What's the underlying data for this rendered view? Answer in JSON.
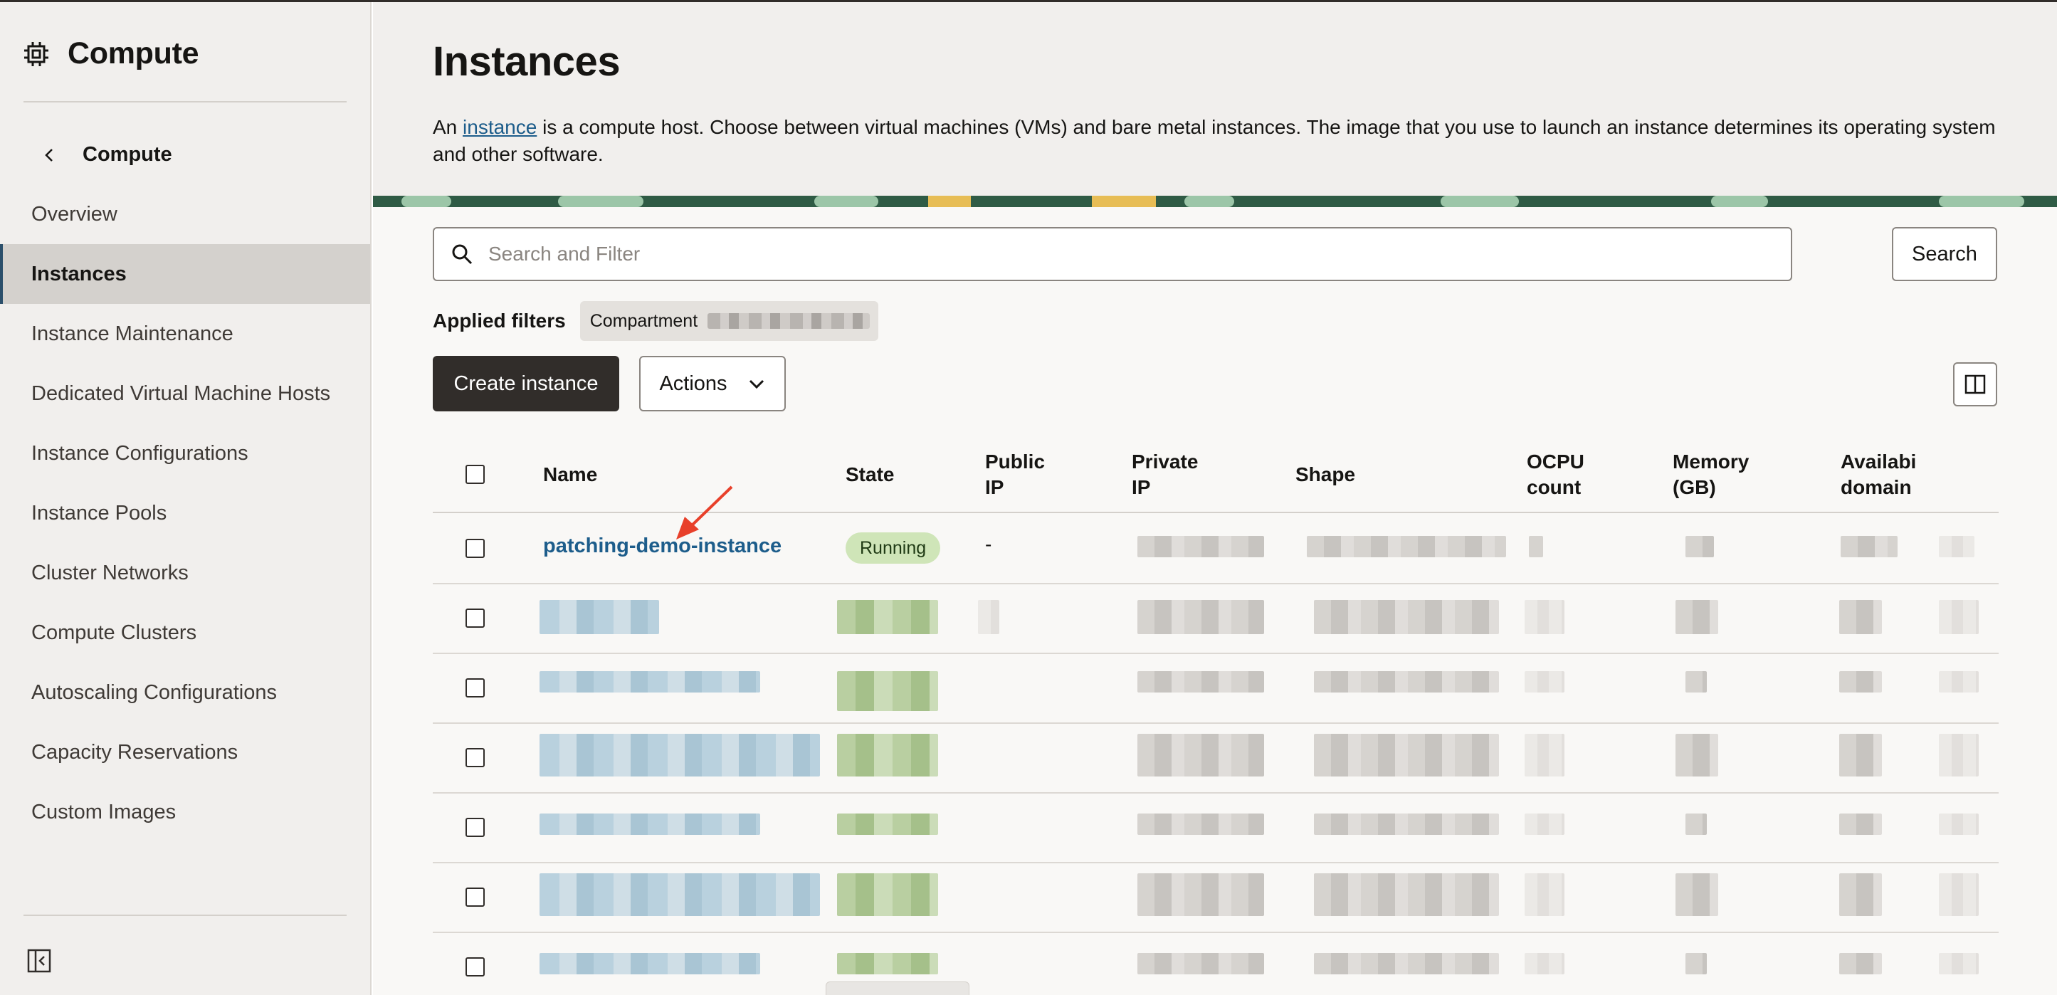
{
  "sidebar": {
    "title": "Compute",
    "back_label": "Compute",
    "items": [
      {
        "label": "Overview"
      },
      {
        "label": "Instances",
        "active": true
      },
      {
        "label": "Instance Maintenance"
      },
      {
        "label": "Dedicated Virtual Machine Hosts"
      },
      {
        "label": "Instance Configurations"
      },
      {
        "label": "Instance Pools"
      },
      {
        "label": "Cluster Networks"
      },
      {
        "label": "Compute Clusters"
      },
      {
        "label": "Autoscaling Configurations"
      },
      {
        "label": "Capacity Reservations"
      },
      {
        "label": "Custom Images"
      }
    ]
  },
  "page": {
    "title": "Instances",
    "desc_prefix": "An ",
    "desc_link": "instance",
    "desc_suffix": " is a compute host. Choose between virtual machines (VMs) and bare metal instances. The image that you use to launch an instance determines its operating system and other software."
  },
  "search": {
    "placeholder": "Search and Filter",
    "button_label": "Search"
  },
  "filters": {
    "label": "Applied filters",
    "chip_label": "Compartment"
  },
  "toolbar": {
    "create_label": "Create instance",
    "actions_label": "Actions"
  },
  "table": {
    "columns": {
      "name": "Name",
      "state": "State",
      "public_ip_1": "Public",
      "public_ip_2": "IP",
      "private_ip_1": "Private",
      "private_ip_2": "IP",
      "shape": "Shape",
      "ocpu_1": "OCPU",
      "ocpu_2": "count",
      "memory_1": "Memory",
      "memory_2": "(GB)",
      "avail_1": "Availabi",
      "avail_2": "domain"
    },
    "first_row": {
      "name": "patching-demo-instance",
      "state": "Running",
      "public_ip": "-"
    }
  },
  "colors": {
    "accent_link": "#1d5d8b",
    "primary_button": "#312d2a",
    "running_badge": "#cfe5b8",
    "annotation_arrow": "#e8402a"
  }
}
